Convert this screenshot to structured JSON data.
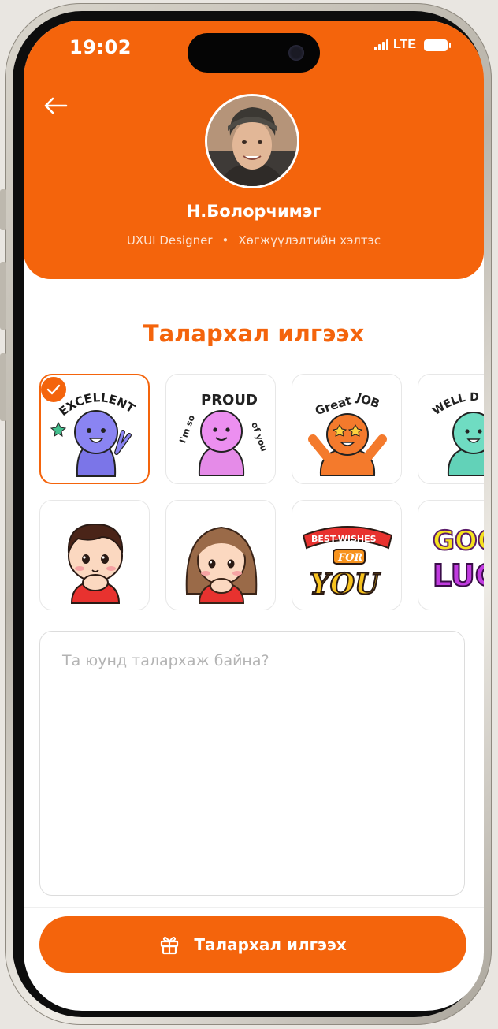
{
  "status_bar": {
    "time": "19:02",
    "network": "LTE"
  },
  "profile": {
    "name": "Н.Болорчимэг",
    "role": "UXUI Designer",
    "separator": "•",
    "department": "Хөгжүүлэлтийн хэлтэс"
  },
  "page_title": "Талархал илгээх",
  "stickers": [
    {
      "name": "excellent-sticker",
      "text": "EXCELLENT",
      "selected": true
    },
    {
      "name": "proud-of-you-sticker",
      "text_1": "I'm so",
      "text_2": "PROUD",
      "text_3": "of you",
      "selected": false
    },
    {
      "name": "great-job-sticker",
      "text_1": "Great",
      "text_2": "JOB",
      "selected": false
    },
    {
      "name": "well-done-sticker",
      "text": "WELL D",
      "selected": false
    },
    {
      "name": "boy-sticker",
      "selected": false
    },
    {
      "name": "girl-sticker",
      "selected": false
    },
    {
      "name": "best-wishes-sticker",
      "text_1": "BEST-WISHES",
      "text_2": "FOR",
      "text_3": "YOU",
      "selected": false
    },
    {
      "name": "good-luck-sticker",
      "text_1": "GOO",
      "text_2": "LUC",
      "selected": false
    }
  ],
  "message": {
    "placeholder": "Та юунд талархаж байна?",
    "value": ""
  },
  "send_button": {
    "label": "Талархал илгээх",
    "icon": "gift-icon"
  },
  "colors": {
    "accent": "#f4640c"
  }
}
